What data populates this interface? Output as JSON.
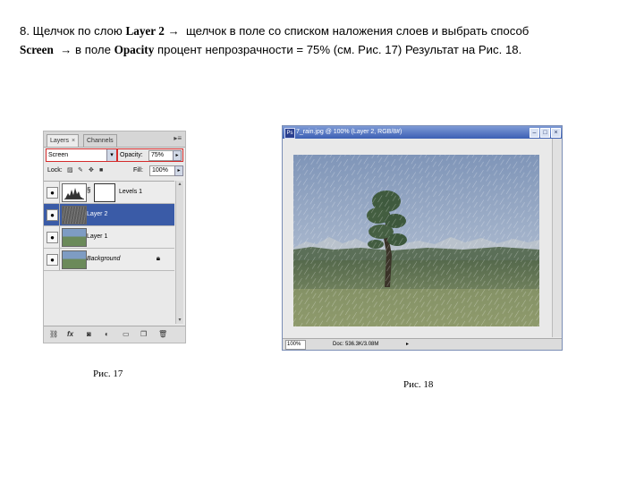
{
  "instruction": {
    "step": "8.",
    "t1": "Щелчок по слою",
    "layer_name": "Layer 2",
    "arrow1": "→",
    "t2": "щелчок в поле со  списком  наложения слоев и выбрать способ",
    "blend_mode": "Screen",
    "arrow2": "→ в поле",
    "opacity_word": "Opacity",
    "t3": "процент непрозрачности = 75% (см. Рис. 17) Результат на Рис. 18."
  },
  "layers_panel": {
    "tabs": [
      {
        "label": "Layers",
        "close": "×"
      },
      {
        "label": "Channels"
      }
    ],
    "menu_icon": "▸≡",
    "blend_mode_value": "Screen",
    "opacity_label": "Opacity:",
    "opacity_value": "75%",
    "lock_label": "Lock:",
    "fill_label": "Fill:",
    "fill_value": "100%",
    "layers": [
      {
        "name": "Levels 1",
        "icon": "levels-adjustment-icon",
        "selected": false
      },
      {
        "name": "Layer 2",
        "selected": true
      },
      {
        "name": "Layer 1",
        "selected": false
      },
      {
        "name": "Background",
        "selected": false,
        "locked": true
      }
    ],
    "bottom_icons": [
      "link-layers-icon",
      "layer-style-icon",
      "layer-mask-icon",
      "adjustment-layer-icon",
      "new-group-icon",
      "new-layer-icon",
      "trash-icon"
    ]
  },
  "document_window": {
    "title": "7_rain.jpg @ 100% (Layer 2, RGB/8#)",
    "zoom": "100%",
    "doc_info": "Doc: 536.3K/3.08M",
    "colors": {
      "titlebar": "#3c5fb4"
    }
  },
  "captions": {
    "fig17": "Рис. 17",
    "fig18": "Рис. 18"
  }
}
